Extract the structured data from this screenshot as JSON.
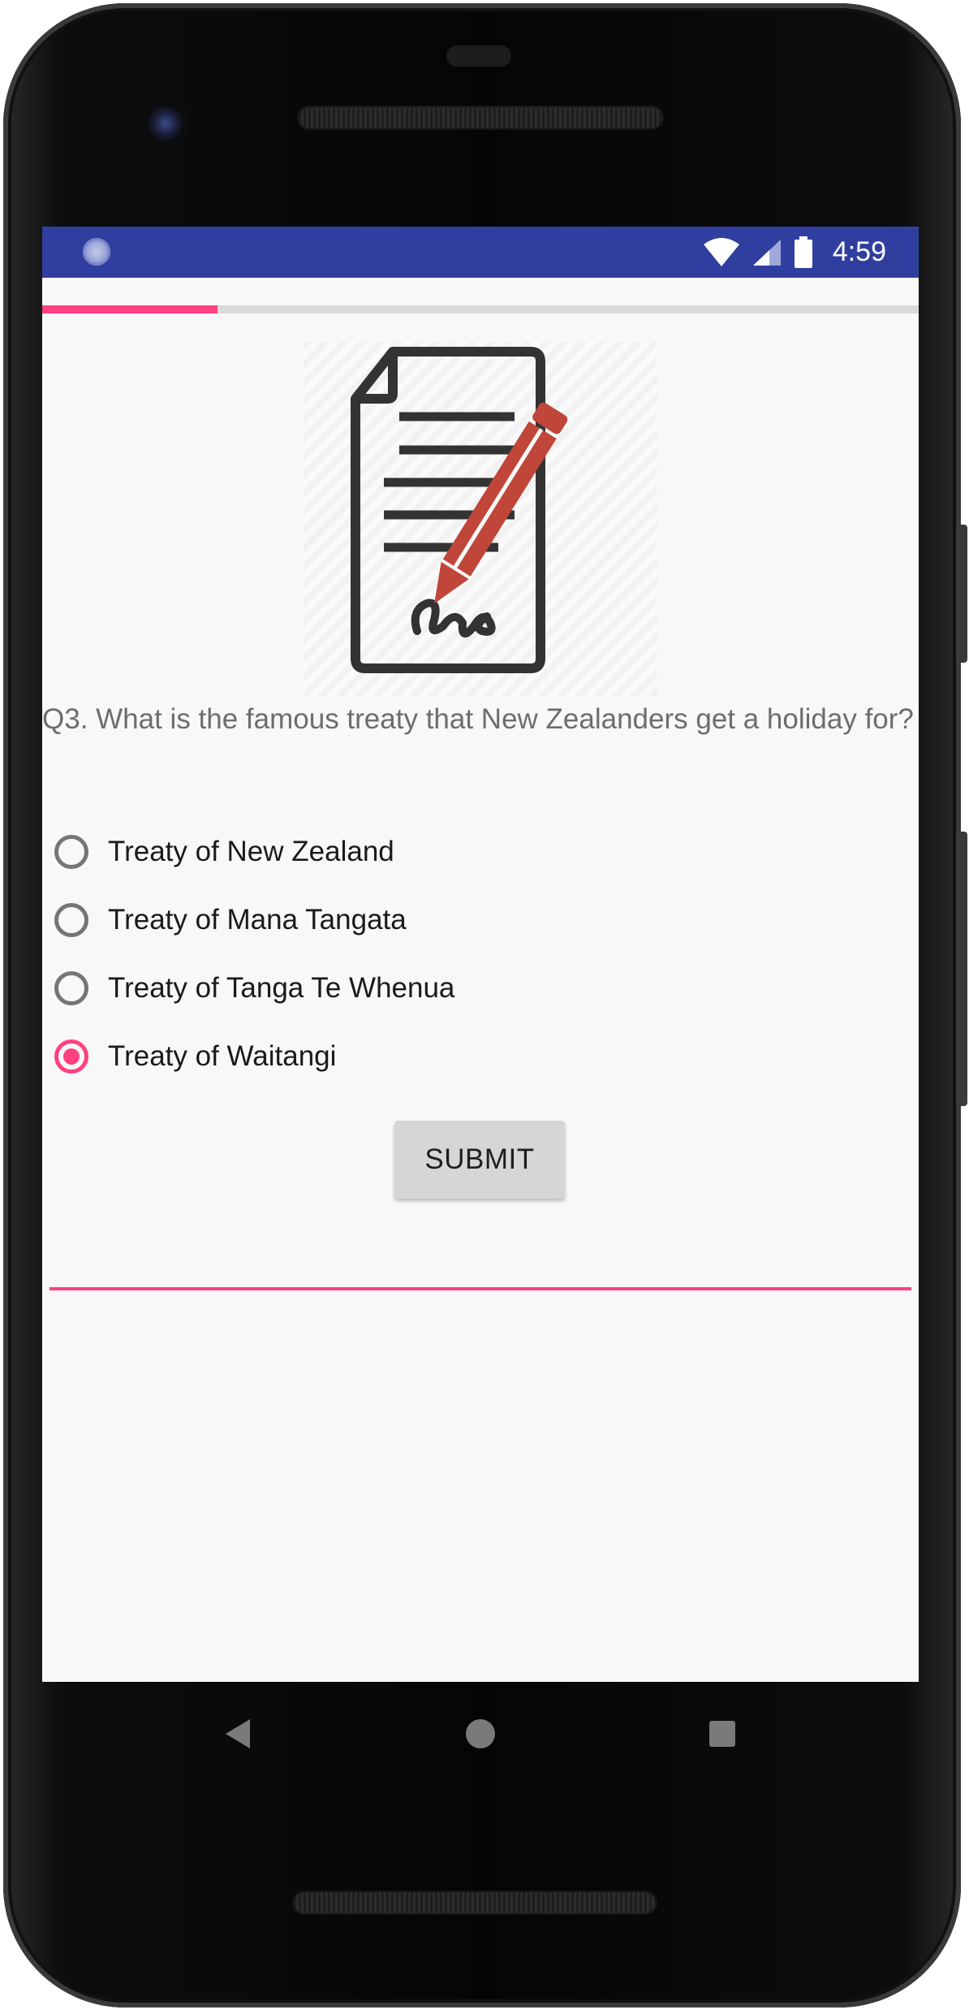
{
  "status_bar": {
    "time": "4:59",
    "icons": [
      "notification-icon",
      "wifi-icon",
      "signal-icon",
      "battery-icon"
    ]
  },
  "quiz": {
    "progress": 0.2,
    "image_name": "document-pen-icon",
    "question": "Q3. What is the famous treaty that New Zealanders get a holiday for?",
    "options": [
      {
        "label": "Treaty of New Zealand",
        "checked": false
      },
      {
        "label": "Treaty of Mana Tangata",
        "checked": false
      },
      {
        "label": "Treaty of Tanga Te Whenua",
        "checked": false
      },
      {
        "label": "Treaty of Waitangi",
        "checked": true
      }
    ],
    "submit_label": "SUBMIT",
    "answer_value": ""
  },
  "navigation": {
    "buttons": [
      "back-icon",
      "home-icon",
      "recents-icon"
    ]
  },
  "colors": {
    "status_bar": "#303f9f",
    "accent": "#ff4081",
    "background": "#f8f8f8",
    "question_text": "#6d6d6d",
    "document_stroke": "#333333",
    "pen": "#c0463a"
  }
}
